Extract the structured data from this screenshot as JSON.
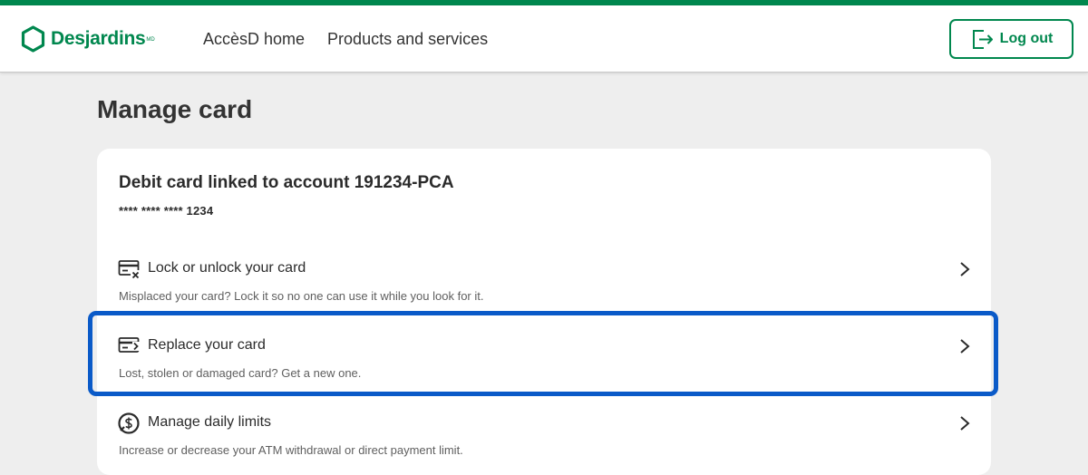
{
  "brand": {
    "name": "Desjardins",
    "mark": "MD",
    "primary_color": "#00874e",
    "focus_color": "#0a5ac8"
  },
  "nav": {
    "items": [
      {
        "label": "AccèsD home"
      },
      {
        "label": "Products and services"
      }
    ]
  },
  "header": {
    "logout_label": "Log out",
    "logout_icon": "logout-icon"
  },
  "page": {
    "title": "Manage card"
  },
  "card": {
    "title": "Debit card linked to account 191234-PCA",
    "number": "**** **** **** 1234",
    "options": [
      {
        "label": "Lock or unlock your card",
        "description": "Misplaced your card? Lock it so no one can use it while you look for it.",
        "icon": "card-lock-icon"
      },
      {
        "label": "Replace your card",
        "description": "Lost, stolen or damaged card? Get a new one.",
        "icon": "card-replace-icon",
        "focused": true
      },
      {
        "label": "Manage daily limits",
        "description": "Increase or decrease your ATM withdrawal or direct payment limit.",
        "icon": "dollar-limit-icon"
      }
    ]
  }
}
